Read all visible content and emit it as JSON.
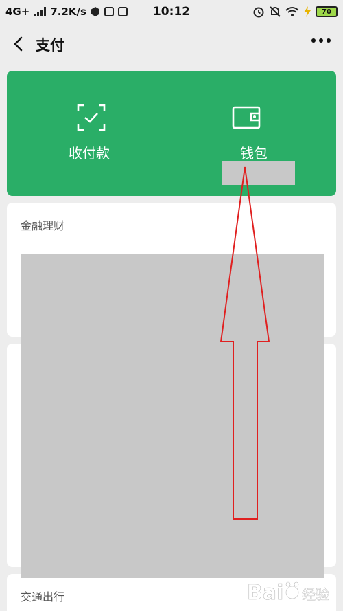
{
  "status_bar": {
    "network": "4G+",
    "speed": "7.2K/s",
    "time": "10:12",
    "battery": "70"
  },
  "nav": {
    "title": "支付"
  },
  "header_card": {
    "color": "#2aae67",
    "actions": [
      {
        "label": "收付款",
        "icon": "scan-qr-icon"
      },
      {
        "label": "钱包",
        "icon": "wallet-icon"
      }
    ]
  },
  "sections": {
    "finance_title": "金融理财",
    "transport_title": "交通出行"
  },
  "annotation": {
    "arrow_color": "#e02020"
  },
  "watermark": {
    "brand_text": "Bai",
    "suffix_text": "经验"
  }
}
